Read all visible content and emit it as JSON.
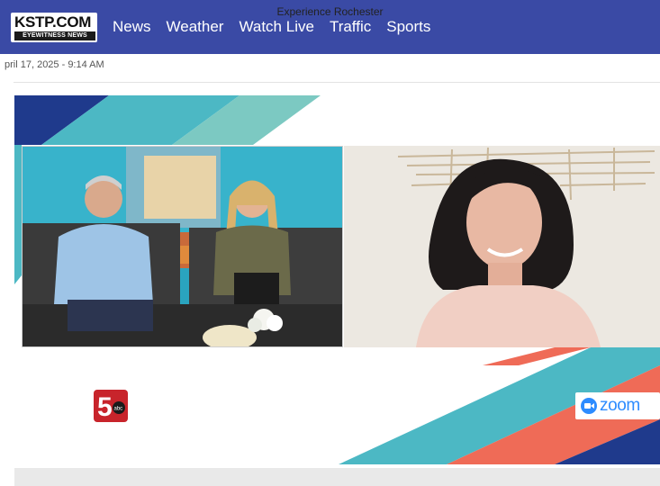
{
  "header": {
    "logo_text": "KSTP.COM",
    "logo_subtext": "EYEWITNESS NEWS",
    "nav": [
      "News",
      "Weather",
      "Watch Live",
      "Traffic",
      "Sports"
    ]
  },
  "article": {
    "dateline": "pril 17, 2025 - 9:14 AM"
  },
  "video": {
    "station_logo_text": "5",
    "station_network_text": "abc",
    "zoom_label": "zoom"
  },
  "caption": "Experience Rochester",
  "colors": {
    "header_bg": "#3a4aa5",
    "teal": "#4cb8c4",
    "coral": "#ef6b57",
    "navy": "#1f3a8c",
    "zoom_blue": "#2d8cff"
  }
}
